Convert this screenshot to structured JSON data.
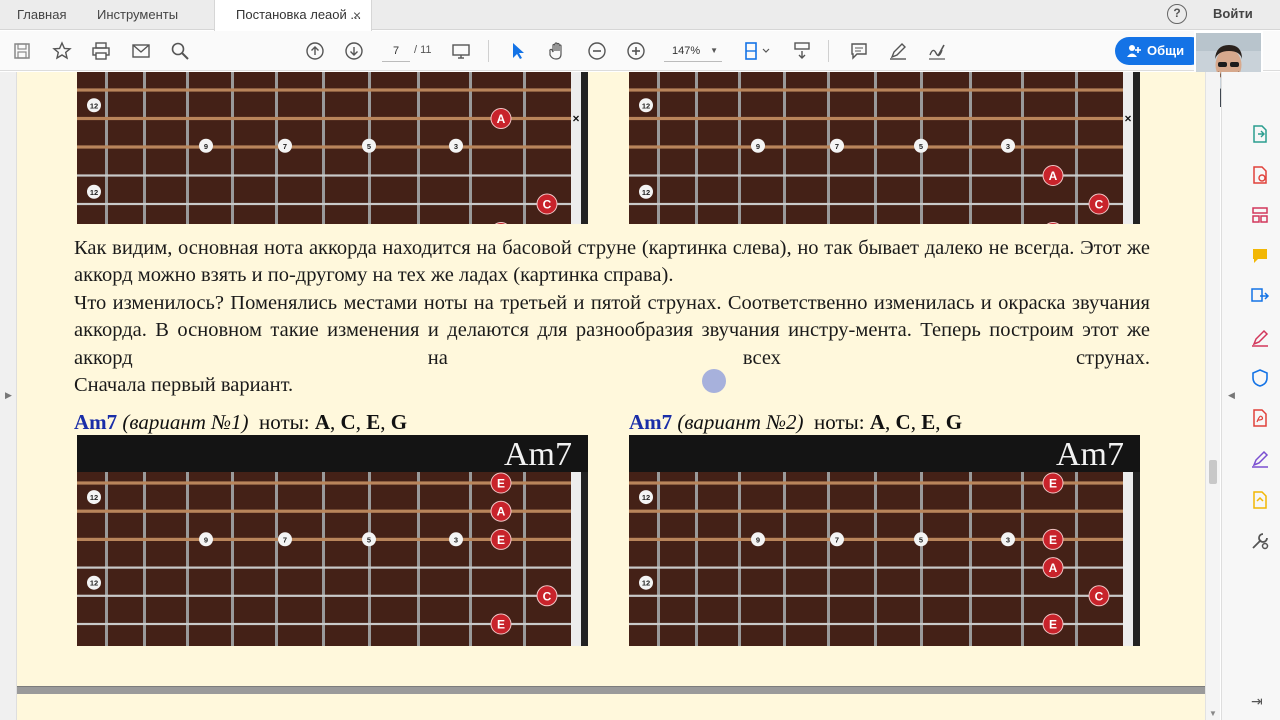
{
  "tabs": {
    "home": "Главная",
    "tools": "Инструменты",
    "document": "Постановка леаой ...",
    "close": "×"
  },
  "header": {
    "help": "?",
    "signin": "Войти"
  },
  "toolbar": {
    "page_current": "7",
    "page_total": "/ 11",
    "zoom": "147%",
    "share_label": "Общи"
  },
  "document": {
    "paragraphs": [
      "Как видим, основная нота аккорда находится на басовой струне (картинка слева), но так бывает далеко не всегда. Этот же аккорд можно взять и по-другому на тех же ладах (картинка справа).",
      "Что изменилось? Поменялись местами ноты на третьей и пятой струнах. Соответственно изменилась и окраска звучания аккорда. В основном такие изменения и делаются для разнообразия звучания инстру-мента. Теперь построим этот же аккорд на всех струнах.",
      "Сначала первый вариант."
    ],
    "chords": [
      {
        "name": "Am7",
        "variant": "(вариант №1)",
        "notes_label": "ноты:",
        "n1": "A",
        "n2": "C",
        "n3": "E",
        "n4": "G",
        "sep": ", "
      },
      {
        "name": "Am7",
        "variant": "(вариант №2)",
        "notes_label": "ноты:",
        "n1": "A",
        "n2": "C",
        "n3": "E",
        "n4": "G",
        "sep": ", "
      }
    ],
    "fretboards": {
      "top_left": {
        "dots": [
          {
            "s": 2,
            "f": 1,
            "n": "A"
          },
          {
            "s": 5,
            "f": 0,
            "n": "C"
          },
          {
            "s": 6,
            "f": 1,
            "n": "E"
          }
        ],
        "mute": true
      },
      "top_right": {
        "dots": [
          {
            "s": 4,
            "f": 1,
            "n": "A"
          },
          {
            "s": 5,
            "f": 0,
            "n": "C"
          },
          {
            "s": 6,
            "f": 1,
            "n": "E"
          }
        ],
        "mute": true
      },
      "bottom_left": {
        "title": "Am7",
        "dots": [
          {
            "s": 1,
            "f": 1,
            "n": "E"
          },
          {
            "s": 2,
            "f": 1,
            "n": "A"
          },
          {
            "s": 3,
            "f": 1,
            "n": "E"
          },
          {
            "s": 5,
            "f": 0,
            "n": "C"
          },
          {
            "s": 6,
            "f": 1,
            "n": "E"
          }
        ]
      },
      "bottom_right": {
        "title": "Am7",
        "dots": [
          {
            "s": 1,
            "f": 1,
            "n": "E"
          },
          {
            "s": 3,
            "f": 1,
            "n": "E"
          },
          {
            "s": 4,
            "f": 1,
            "n": "A"
          },
          {
            "s": 5,
            "f": 0,
            "n": "C"
          },
          {
            "s": 6,
            "f": 1,
            "n": "E"
          }
        ]
      }
    },
    "inlay_markers": [
      "12",
      "9",
      "7",
      "5",
      "3",
      "12"
    ],
    "mute_mark": "×"
  },
  "colors": {
    "page_bg": "#fff8dc",
    "accent": "#1473e6",
    "chord_name": "#1a2ea8",
    "note_dot": "#c8232b"
  }
}
